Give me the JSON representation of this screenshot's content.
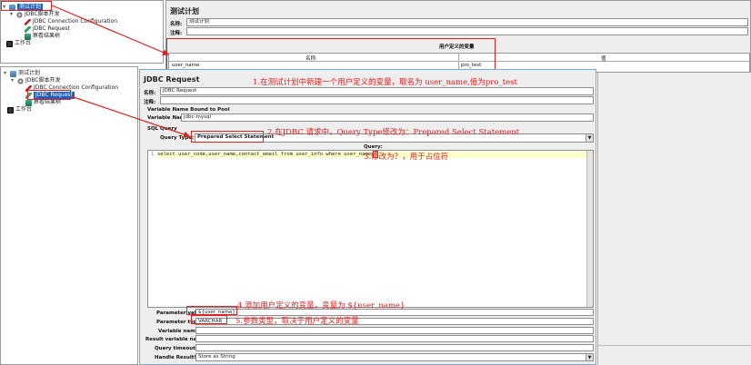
{
  "top_tree": {
    "items": [
      {
        "label": "测试计划",
        "selected": true
      },
      {
        "label": "JDBC脚本开发"
      },
      {
        "label": "JDBC Connection Configuration"
      },
      {
        "label": "JDBC Request"
      },
      {
        "label": "察看结果树"
      },
      {
        "label": "工作台"
      }
    ]
  },
  "test_plan": {
    "title": "测试计划",
    "name_label": "名称:",
    "name_value": "测试计划",
    "comment_label": "注释:",
    "udv_title": "用户定义的变量",
    "col_name": "名称:",
    "col_value": "值",
    "row_name": "user_name",
    "row_value": "pro_test"
  },
  "bottom_tree": {
    "items": [
      {
        "label": "测试计划"
      },
      {
        "label": "JDBC脚本开发"
      },
      {
        "label": "JDBC Connection Configuration"
      },
      {
        "label": "JDBC Request",
        "selected": true
      },
      {
        "label": "察看结果树"
      },
      {
        "label": "工作台"
      }
    ]
  },
  "jdbc": {
    "title": "JDBC Request",
    "name_label": "名称:",
    "name_value": "JDBC Request",
    "comment_label": "注释:",
    "pool_section": "Variable Name Bound to Pool",
    "var_name_label": "Variable Name:",
    "var_name_value": "jdbc-mysql",
    "sql_section": "SQL Query",
    "query_type_label": "Query Type:",
    "query_type_value": "Prepared Select Statement",
    "query_label": "Query:",
    "line_no": "1",
    "sql_prefix": "select user_code,user_name,contact_email from user_info where user_name=",
    "sql_placeholder": "?",
    "param_values_label": "Parameter values:",
    "param_values_value": "${user_name}",
    "param_types_label": "Parameter types:",
    "param_types_value": "VARCHAR",
    "var_names_label": "Variable names:",
    "result_var_label": "Result variable name:",
    "timeout_label": "Query timeout (s):",
    "handle_label": "Handle ResultSet:",
    "handle_value": "Store as String"
  },
  "annotations": {
    "a1": "1.在测试计划中新建一个用户定义的变量，取名为 user_name,值为pro_test",
    "a2": "2.在JDBC 请求中，Query Type修改为：Prepared Select Statement",
    "a3": "3.修改为？，用于占位符",
    "a4": "4.添加用户定义的变量，变量为 ${user_name}",
    "a5": "5.参数类型，取决于用户定义的变量"
  },
  "colors": {
    "annotation": "#e02020",
    "selection": "#1f5fbf"
  }
}
